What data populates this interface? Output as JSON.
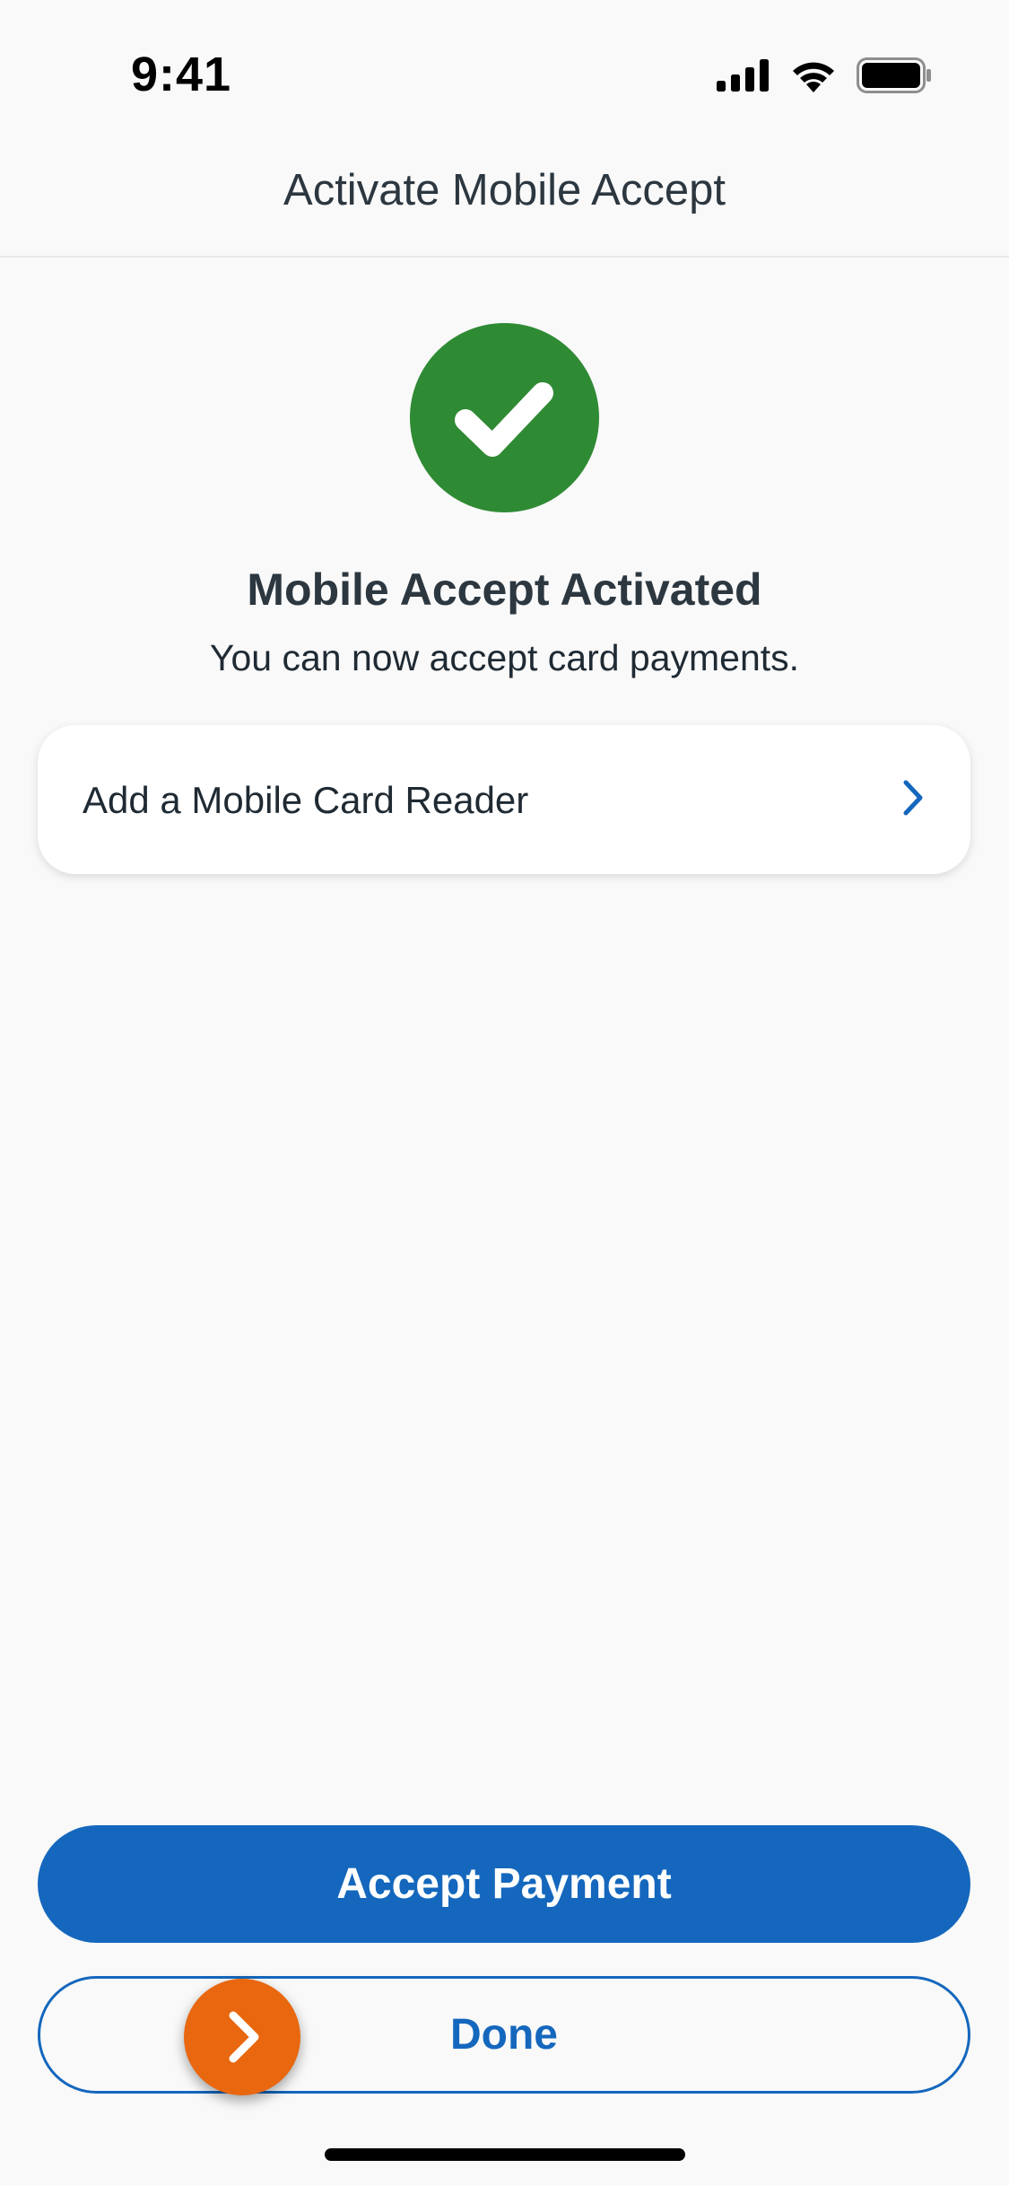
{
  "status_bar": {
    "time": "9:41",
    "icons": [
      "cellular-signal-icon",
      "wifi-icon",
      "battery-icon"
    ]
  },
  "nav": {
    "title": "Activate Mobile Accept"
  },
  "success": {
    "icon": "checkmark-icon",
    "title": "Mobile Accept Activated",
    "subtitle": "You can now accept card payments."
  },
  "card_row": {
    "label": "Add a Mobile Card Reader",
    "icon": "chevron-right-icon"
  },
  "actions": {
    "primary_label": "Accept Payment",
    "secondary_label": "Done"
  },
  "fab": {
    "icon": "chevron-right-icon"
  },
  "colors": {
    "brand_blue": "#1467bd",
    "success_green": "#2f8a34",
    "accent_orange": "#e8670f",
    "background": "#f9f9f9"
  }
}
